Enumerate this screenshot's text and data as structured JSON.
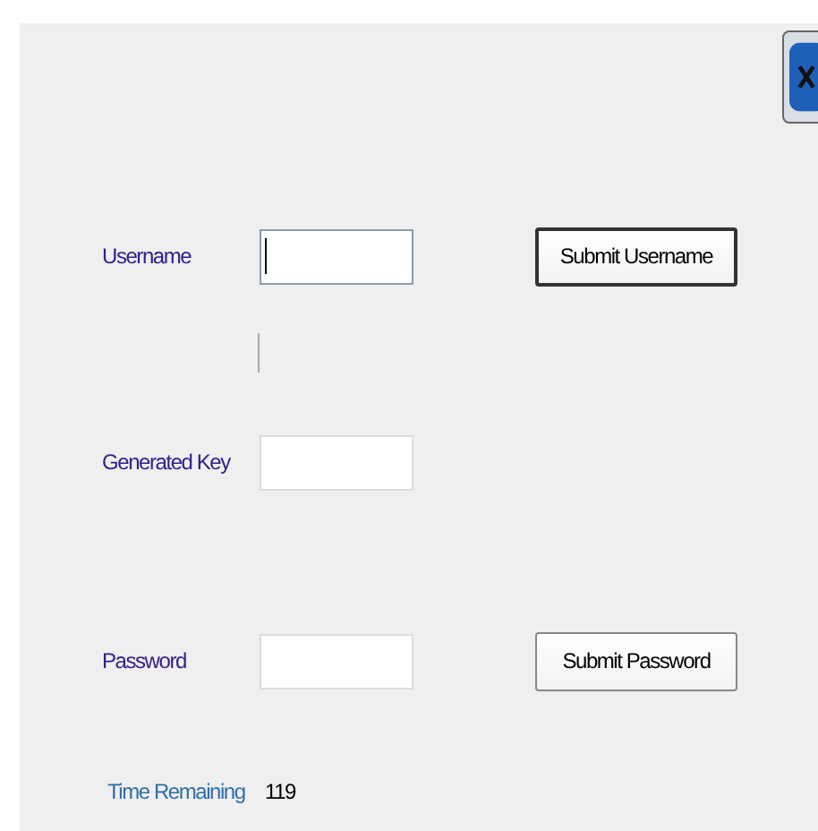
{
  "close_button": {
    "kind": "close"
  },
  "fields": [
    {
      "label": "Username",
      "focused": true,
      "button": "Submit Username"
    },
    {
      "label": "Generated Key",
      "focused": false
    },
    {
      "label": "Password",
      "focused": false,
      "button": "Submit Password"
    }
  ],
  "timer": {
    "label": "Time Remaining",
    "value": "119"
  }
}
